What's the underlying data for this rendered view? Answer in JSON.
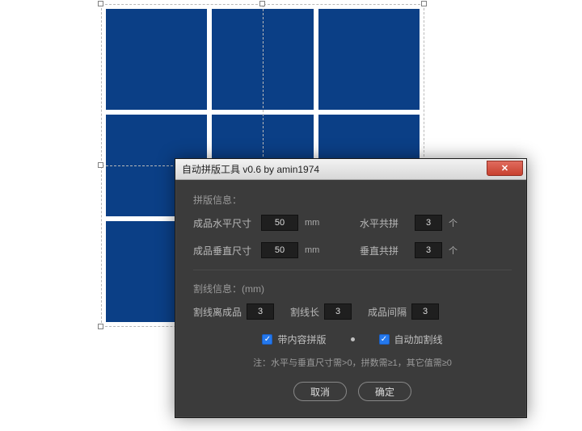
{
  "canvas": {
    "grid_rows": 3,
    "grid_cols": 3,
    "cell_color": "#0b3f86"
  },
  "dialog": {
    "title": "自动拼版工具 v0.6   by amin1974",
    "close_glyph": "✕",
    "section1_title": "拼版信息：",
    "size_h_label": "成品水平尺寸",
    "size_h_value": "50",
    "size_v_label": "成品垂直尺寸",
    "size_v_value": "50",
    "unit_mm": "mm",
    "count_h_label": "水平共拼",
    "count_h_value": "3",
    "count_v_label": "垂直共拼",
    "count_v_value": "3",
    "unit_piece": "个",
    "section2_title": "割线信息：(mm)",
    "cutline_offset_label": "割线离成品",
    "cutline_offset_value": "3",
    "cutline_len_label": "割线长",
    "cutline_len_value": "3",
    "gap_label": "成品间隔",
    "gap_value": "3",
    "chk1_label": "带内容拼版",
    "chk1_checked": true,
    "chk2_label": "自动加割线",
    "chk2_checked": true,
    "note": "注：水平与垂直尺寸需>0，拼数需≥1，其它值需≥0",
    "btn_cancel": "取消",
    "btn_ok": "确定"
  }
}
